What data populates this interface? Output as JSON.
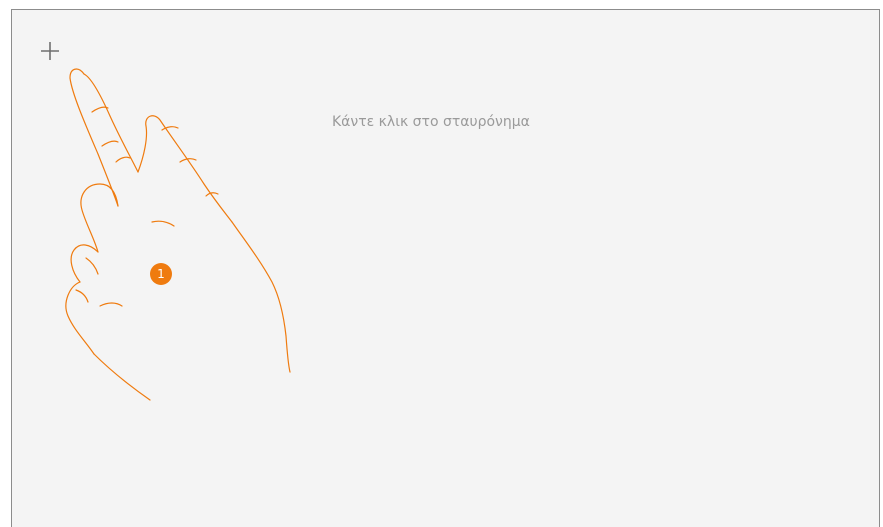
{
  "instruction_text": "Κάντε κλικ στο σταυρόνημα",
  "step_badge": "1",
  "icons": {
    "target": "crosshair-plus-icon",
    "hand": "pointing-hand-icon"
  },
  "colors": {
    "background": "#f4f4f4",
    "accent": "#ef7b0f",
    "text": "#9a9a9a",
    "crosshair": "#6f6f6f"
  }
}
